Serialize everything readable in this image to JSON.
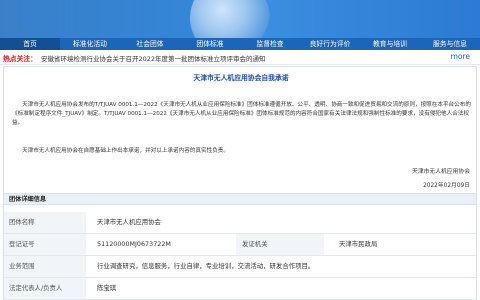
{
  "nav": {
    "items": [
      "首页",
      "标准化活动",
      "社会团体",
      "团体标准",
      "监督检查",
      "良好行为评价",
      "教育与培训",
      "服务与信息"
    ]
  },
  "hot": {
    "label": "热点关注：",
    "text": "安徽省环境检测行业协会关于召开2022年度第一批团体标准立项评审会的通知",
    "more": "more"
  },
  "doc": {
    "title": "天津市无人机应用协会自我承诺",
    "p1": "天津市无人机应用协会发布的T/TJUAV 0001.1—2022《天津市无人机从业应用保险标准》团体标准遵循开放、公平、透明、协商一致和促进贸易和交流的原则，按照在本平台公布的《标准制定程序文件_TJUAV》制定。T/TJUAV 0001.1—2022《天津市无人机从业应用保险标准》团体标准规范的内容符合国家有关法律法规和强制性标准的要求，没有侵犯他人合法权益。",
    "p2": "天津市无人机应用协会在自愿基础上作出本承诺，并对以上承诺内容的真实性负责。",
    "signer": "天津市无人机应用协会",
    "date": "2022年02月09日"
  },
  "details": {
    "header": "团体详细信息",
    "rows": [
      {
        "label": "团体名称",
        "value": "天津市无人机应用协会"
      },
      {
        "label": "登记证号",
        "value": "51120000MJ0673722M",
        "label2": "发证机关",
        "value2": "天津市民政局"
      },
      {
        "label": "业务范围",
        "value": "行业调查研究，信息服务，行业自律，专业培训，交流活动，研发合作项目。"
      },
      {
        "label": "法定代表人/负责人",
        "value": "陈宝琪"
      }
    ]
  }
}
